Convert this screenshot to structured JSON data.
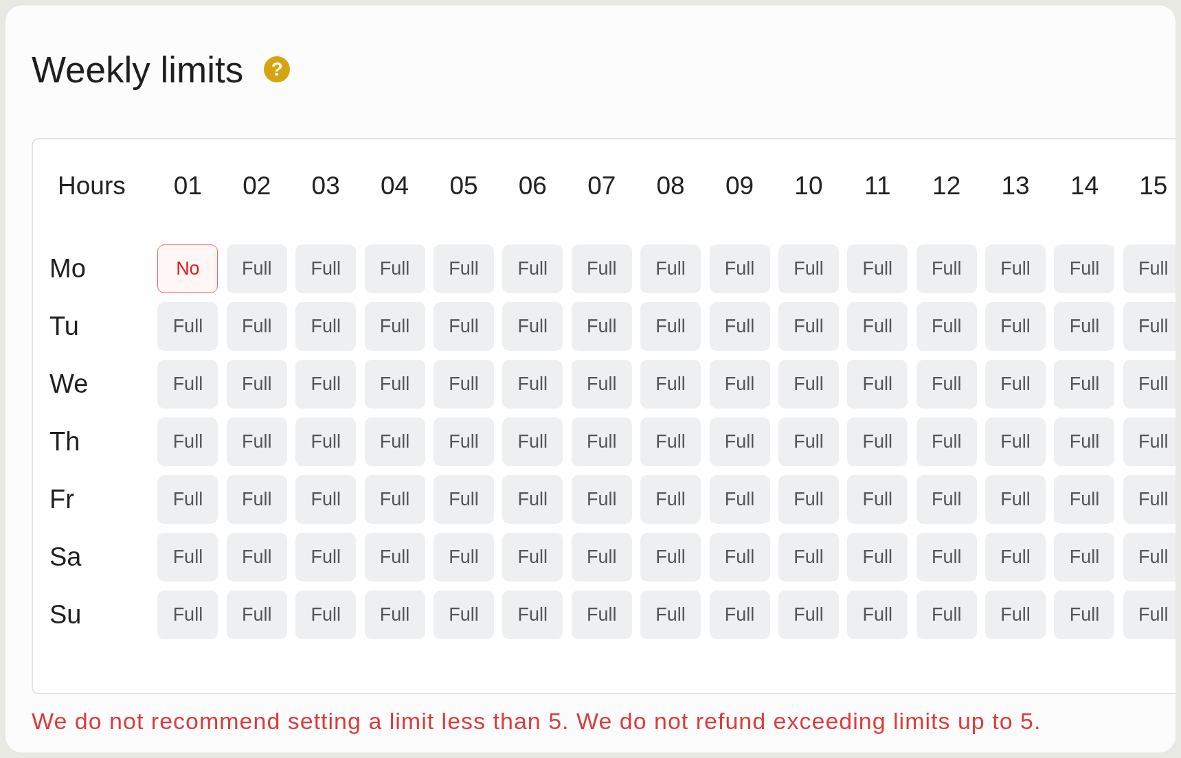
{
  "title": "Weekly limits",
  "help_button": "?",
  "grid": {
    "corner": "Hours",
    "hours": [
      "01",
      "02",
      "03",
      "04",
      "05",
      "06",
      "07",
      "08",
      "09",
      "10",
      "11",
      "12",
      "13",
      "14",
      "15"
    ],
    "rows": [
      {
        "day": "Mo",
        "cells": [
          {
            "label": "No",
            "kind": "no"
          },
          {
            "label": "Full",
            "kind": "full"
          },
          {
            "label": "Full",
            "kind": "full"
          },
          {
            "label": "Full",
            "kind": "full"
          },
          {
            "label": "Full",
            "kind": "full"
          },
          {
            "label": "Full",
            "kind": "full"
          },
          {
            "label": "Full",
            "kind": "full"
          },
          {
            "label": "Full",
            "kind": "full"
          },
          {
            "label": "Full",
            "kind": "full"
          },
          {
            "label": "Full",
            "kind": "full"
          },
          {
            "label": "Full",
            "kind": "full"
          },
          {
            "label": "Full",
            "kind": "full"
          },
          {
            "label": "Full",
            "kind": "full"
          },
          {
            "label": "Full",
            "kind": "full"
          },
          {
            "label": "Full",
            "kind": "full"
          }
        ]
      },
      {
        "day": "Tu",
        "cells": [
          {
            "label": "Full",
            "kind": "full"
          },
          {
            "label": "Full",
            "kind": "full"
          },
          {
            "label": "Full",
            "kind": "full"
          },
          {
            "label": "Full",
            "kind": "full"
          },
          {
            "label": "Full",
            "kind": "full"
          },
          {
            "label": "Full",
            "kind": "full"
          },
          {
            "label": "Full",
            "kind": "full"
          },
          {
            "label": "Full",
            "kind": "full"
          },
          {
            "label": "Full",
            "kind": "full"
          },
          {
            "label": "Full",
            "kind": "full"
          },
          {
            "label": "Full",
            "kind": "full"
          },
          {
            "label": "Full",
            "kind": "full"
          },
          {
            "label": "Full",
            "kind": "full"
          },
          {
            "label": "Full",
            "kind": "full"
          },
          {
            "label": "Full",
            "kind": "full"
          }
        ]
      },
      {
        "day": "We",
        "cells": [
          {
            "label": "Full",
            "kind": "full"
          },
          {
            "label": "Full",
            "kind": "full"
          },
          {
            "label": "Full",
            "kind": "full"
          },
          {
            "label": "Full",
            "kind": "full"
          },
          {
            "label": "Full",
            "kind": "full"
          },
          {
            "label": "Full",
            "kind": "full"
          },
          {
            "label": "Full",
            "kind": "full"
          },
          {
            "label": "Full",
            "kind": "full"
          },
          {
            "label": "Full",
            "kind": "full"
          },
          {
            "label": "Full",
            "kind": "full"
          },
          {
            "label": "Full",
            "kind": "full"
          },
          {
            "label": "Full",
            "kind": "full"
          },
          {
            "label": "Full",
            "kind": "full"
          },
          {
            "label": "Full",
            "kind": "full"
          },
          {
            "label": "Full",
            "kind": "full"
          }
        ]
      },
      {
        "day": "Th",
        "cells": [
          {
            "label": "Full",
            "kind": "full"
          },
          {
            "label": "Full",
            "kind": "full"
          },
          {
            "label": "Full",
            "kind": "full"
          },
          {
            "label": "Full",
            "kind": "full"
          },
          {
            "label": "Full",
            "kind": "full"
          },
          {
            "label": "Full",
            "kind": "full"
          },
          {
            "label": "Full",
            "kind": "full"
          },
          {
            "label": "Full",
            "kind": "full"
          },
          {
            "label": "Full",
            "kind": "full"
          },
          {
            "label": "Full",
            "kind": "full"
          },
          {
            "label": "Full",
            "kind": "full"
          },
          {
            "label": "Full",
            "kind": "full"
          },
          {
            "label": "Full",
            "kind": "full"
          },
          {
            "label": "Full",
            "kind": "full"
          },
          {
            "label": "Full",
            "kind": "full"
          }
        ]
      },
      {
        "day": "Fr",
        "cells": [
          {
            "label": "Full",
            "kind": "full"
          },
          {
            "label": "Full",
            "kind": "full"
          },
          {
            "label": "Full",
            "kind": "full"
          },
          {
            "label": "Full",
            "kind": "full"
          },
          {
            "label": "Full",
            "kind": "full"
          },
          {
            "label": "Full",
            "kind": "full"
          },
          {
            "label": "Full",
            "kind": "full"
          },
          {
            "label": "Full",
            "kind": "full"
          },
          {
            "label": "Full",
            "kind": "full"
          },
          {
            "label": "Full",
            "kind": "full"
          },
          {
            "label": "Full",
            "kind": "full"
          },
          {
            "label": "Full",
            "kind": "full"
          },
          {
            "label": "Full",
            "kind": "full"
          },
          {
            "label": "Full",
            "kind": "full"
          },
          {
            "label": "Full",
            "kind": "full"
          }
        ]
      },
      {
        "day": "Sa",
        "cells": [
          {
            "label": "Full",
            "kind": "full"
          },
          {
            "label": "Full",
            "kind": "full"
          },
          {
            "label": "Full",
            "kind": "full"
          },
          {
            "label": "Full",
            "kind": "full"
          },
          {
            "label": "Full",
            "kind": "full"
          },
          {
            "label": "Full",
            "kind": "full"
          },
          {
            "label": "Full",
            "kind": "full"
          },
          {
            "label": "Full",
            "kind": "full"
          },
          {
            "label": "Full",
            "kind": "full"
          },
          {
            "label": "Full",
            "kind": "full"
          },
          {
            "label": "Full",
            "kind": "full"
          },
          {
            "label": "Full",
            "kind": "full"
          },
          {
            "label": "Full",
            "kind": "full"
          },
          {
            "label": "Full",
            "kind": "full"
          },
          {
            "label": "Full",
            "kind": "full"
          }
        ]
      },
      {
        "day": "Su",
        "cells": [
          {
            "label": "Full",
            "kind": "full"
          },
          {
            "label": "Full",
            "kind": "full"
          },
          {
            "label": "Full",
            "kind": "full"
          },
          {
            "label": "Full",
            "kind": "full"
          },
          {
            "label": "Full",
            "kind": "full"
          },
          {
            "label": "Full",
            "kind": "full"
          },
          {
            "label": "Full",
            "kind": "full"
          },
          {
            "label": "Full",
            "kind": "full"
          },
          {
            "label": "Full",
            "kind": "full"
          },
          {
            "label": "Full",
            "kind": "full"
          },
          {
            "label": "Full",
            "kind": "full"
          },
          {
            "label": "Full",
            "kind": "full"
          },
          {
            "label": "Full",
            "kind": "full"
          },
          {
            "label": "Full",
            "kind": "full"
          },
          {
            "label": "Full",
            "kind": "full"
          }
        ]
      }
    ]
  },
  "warning": "We do not recommend setting a limit less than 5. We do not refund exceeding limits up to 5."
}
